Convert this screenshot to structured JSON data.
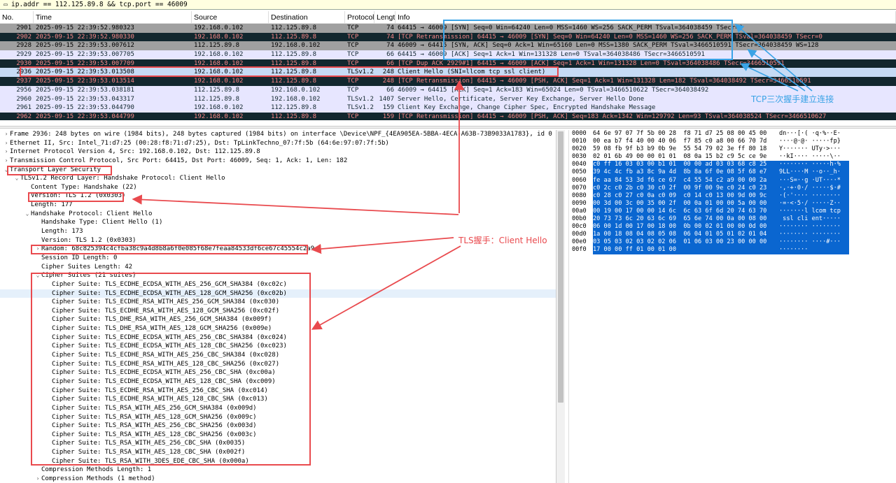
{
  "filter": {
    "icon": "bookmark-icon",
    "text": "ip.addr == 112.125.89.8 && tcp.port == 46009"
  },
  "columns": [
    "No.",
    "Time",
    "Source",
    "Destination",
    "Protocol",
    "Length",
    "Info"
  ],
  "packets": [
    {
      "no": "2901",
      "time": "2025-09-15 22:39:52.980323",
      "src": "192.168.0.102",
      "dst": "112.125.89.8",
      "proto": "TCP",
      "len": "74",
      "info": "64415 → 46009 [SYN] Seq=0 Win=64240 Len=0 MSS=1460 WS=256 SACK_PERM TSval=364038459 TSecr=0",
      "style": "gray"
    },
    {
      "no": "2902",
      "time": "2025-09-15 22:39:52.980330",
      "src": "192.168.0.102",
      "dst": "112.125.89.8",
      "proto": "TCP",
      "len": "74",
      "info": "[TCP Retransmission] 64415 → 46009 [SYN] Seq=0 Win=64240 Len=0 MSS=1460 WS=256 SACK_PERM TSval=364038459 TSecr=0",
      "style": "dark"
    },
    {
      "no": "2928",
      "time": "2025-09-15 22:39:53.007612",
      "src": "112.125.89.8",
      "dst": "192.168.0.102",
      "proto": "TCP",
      "len": "74",
      "info": "46009 → 64415 [SYN, ACK] Seq=0 Ack=1 Win=65160 Len=0 MSS=1380 SACK_PERM TSval=3466510591 TSecr=364038459 WS=128",
      "style": "gray"
    },
    {
      "no": "2929",
      "time": "2025-09-15 22:39:53.007705",
      "src": "192.168.0.102",
      "dst": "112.125.89.8",
      "proto": "TCP",
      "len": "66",
      "info": "64415 → 46009 [ACK] Seq=1 Ack=1 Win=131328 Len=0 TSval=364038486 TSecr=3466510591",
      "style": "lav"
    },
    {
      "no": "2930",
      "time": "2025-09-15 22:39:53.007709",
      "src": "192.168.0.102",
      "dst": "112.125.89.8",
      "proto": "TCP",
      "len": "66",
      "info": "[TCP Dup ACK 2929#1] 64415 → 46009 [ACK] Seq=1 Ack=1 Win=131328 Len=0 TSval=364038486 TSecr=3466510591",
      "style": "dark"
    },
    {
      "no": "2936",
      "time": "2025-09-15 22:39:53.013508",
      "src": "192.168.0.102",
      "dst": "112.125.89.8",
      "proto": "TLSv1.2",
      "len": "248",
      "info": "Client Hello (SNI=llcom tcp ssl client)",
      "style": "sel"
    },
    {
      "no": "2937",
      "time": "2025-09-15 22:39:53.013514",
      "src": "192.168.0.102",
      "dst": "112.125.89.8",
      "proto": "TCP",
      "len": "248",
      "info": "[TCP Retransmission] 64415 → 46009 [PSH, ACK] Seq=1 Ack=1 Win=131328 Len=182 TSval=364038492 TSecr=3466510591",
      "style": "dark"
    },
    {
      "no": "2956",
      "time": "2025-09-15 22:39:53.038181",
      "src": "112.125.89.8",
      "dst": "192.168.0.102",
      "proto": "TCP",
      "len": "66",
      "info": "46009 → 64415 [ACK] Seq=1 Ack=183 Win=65024 Len=0 TSval=3466510622 TSecr=364038492",
      "style": "lav"
    },
    {
      "no": "2960",
      "time": "2025-09-15 22:39:53.043317",
      "src": "112.125.89.8",
      "dst": "192.168.0.102",
      "proto": "TLSv1.2",
      "len": "1407",
      "info": "Server Hello, Certificate, Server Key Exchange, Server Hello Done",
      "style": "lav"
    },
    {
      "no": "2961",
      "time": "2025-09-15 22:39:53.044790",
      "src": "192.168.0.102",
      "dst": "112.125.89.8",
      "proto": "TLSv1.2",
      "len": "159",
      "info": "Client Key Exchange, Change Cipher Spec, Encrypted Handshake Message",
      "style": "lav"
    },
    {
      "no": "2962",
      "time": "2025-09-15 22:39:53.044799",
      "src": "192.168.0.102",
      "dst": "112.125.89.8",
      "proto": "TCP",
      "len": "159",
      "info": "[TCP Retransmission] 64415 → 46009 [PSH, ACK] Seq=183 Ack=1342 Win=129792 Len=93 TSval=364038524 TSecr=3466510627",
      "style": "dark"
    }
  ],
  "details": [
    {
      "indent": 0,
      "tw": "›",
      "text": "Frame 2936: 248 bytes on wire (1984 bits), 248 bytes captured (1984 bits) on interface \\Device\\NPF_{4EA905EA-5BBA-4ECA-A63B-73B9033A1783}, id 0"
    },
    {
      "indent": 0,
      "tw": "›",
      "text": "Ethernet II, Src: Intel_71:d7:25 (00:28:f8:71:d7:25), Dst: TpLinkTechno_07:7f:5b (64:6e:97:07:7f:5b)"
    },
    {
      "indent": 0,
      "tw": "›",
      "text": "Internet Protocol Version 4, Src: 192.168.0.102, Dst: 112.125.89.8"
    },
    {
      "indent": 0,
      "tw": "›",
      "text": "Transmission Control Protocol, Src Port: 64415, Dst Port: 46009, Seq: 1, Ack: 1, Len: 182"
    },
    {
      "indent": 0,
      "tw": "⌄",
      "text": "Transport Layer Security"
    },
    {
      "indent": 1,
      "tw": "⌄",
      "text": "TLSv1.2 Record Layer: Handshake Protocol: Client Hello"
    },
    {
      "indent": 2,
      "tw": "",
      "text": "Content Type: Handshake (22)"
    },
    {
      "indent": 2,
      "tw": "",
      "text": "Version: TLS 1.2 (0x0303)"
    },
    {
      "indent": 2,
      "tw": "",
      "text": "Length: 177"
    },
    {
      "indent": 2,
      "tw": "⌄",
      "text": "Handshake Protocol: Client Hello"
    },
    {
      "indent": 3,
      "tw": "",
      "text": "Handshake Type: Client Hello (1)"
    },
    {
      "indent": 3,
      "tw": "",
      "text": "Length: 173"
    },
    {
      "indent": 3,
      "tw": "",
      "text": "Version: TLS 1.2 (0x0303)"
    },
    {
      "indent": 3,
      "tw": "›",
      "text": "Random: 68c825394c4cfba38c9a4d8b8a6f0e085f68e7feaa84533df6ce67c45554c2a9"
    },
    {
      "indent": 3,
      "tw": "",
      "text": "Session ID Length: 0"
    },
    {
      "indent": 3,
      "tw": "",
      "text": "Cipher Suites Length: 42"
    },
    {
      "indent": 3,
      "tw": "⌄",
      "text": "Cipher Suites (21 suites)"
    },
    {
      "indent": 4,
      "tw": "",
      "text": "Cipher Suite: TLS_ECDHE_ECDSA_WITH_AES_256_GCM_SHA384 (0xc02c)"
    },
    {
      "indent": 4,
      "tw": "",
      "text": "Cipher Suite: TLS_ECDHE_ECDSA_WITH_AES_128_GCM_SHA256 (0xc02b)",
      "hl": true
    },
    {
      "indent": 4,
      "tw": "",
      "text": "Cipher Suite: TLS_ECDHE_RSA_WITH_AES_256_GCM_SHA384 (0xc030)"
    },
    {
      "indent": 4,
      "tw": "",
      "text": "Cipher Suite: TLS_ECDHE_RSA_WITH_AES_128_GCM_SHA256 (0xc02f)"
    },
    {
      "indent": 4,
      "tw": "",
      "text": "Cipher Suite: TLS_DHE_RSA_WITH_AES_256_GCM_SHA384 (0x009f)"
    },
    {
      "indent": 4,
      "tw": "",
      "text": "Cipher Suite: TLS_DHE_RSA_WITH_AES_128_GCM_SHA256 (0x009e)"
    },
    {
      "indent": 4,
      "tw": "",
      "text": "Cipher Suite: TLS_ECDHE_ECDSA_WITH_AES_256_CBC_SHA384 (0xc024)"
    },
    {
      "indent": 4,
      "tw": "",
      "text": "Cipher Suite: TLS_ECDHE_ECDSA_WITH_AES_128_CBC_SHA256 (0xc023)"
    },
    {
      "indent": 4,
      "tw": "",
      "text": "Cipher Suite: TLS_ECDHE_RSA_WITH_AES_256_CBC_SHA384 (0xc028)"
    },
    {
      "indent": 4,
      "tw": "",
      "text": "Cipher Suite: TLS_ECDHE_RSA_WITH_AES_128_CBC_SHA256 (0xc027)"
    },
    {
      "indent": 4,
      "tw": "",
      "text": "Cipher Suite: TLS_ECDHE_ECDSA_WITH_AES_256_CBC_SHA (0xc00a)"
    },
    {
      "indent": 4,
      "tw": "",
      "text": "Cipher Suite: TLS_ECDHE_ECDSA_WITH_AES_128_CBC_SHA (0xc009)"
    },
    {
      "indent": 4,
      "tw": "",
      "text": "Cipher Suite: TLS_ECDHE_RSA_WITH_AES_256_CBC_SHA (0xc014)"
    },
    {
      "indent": 4,
      "tw": "",
      "text": "Cipher Suite: TLS_ECDHE_RSA_WITH_AES_128_CBC_SHA (0xc013)"
    },
    {
      "indent": 4,
      "tw": "",
      "text": "Cipher Suite: TLS_RSA_WITH_AES_256_GCM_SHA384 (0x009d)"
    },
    {
      "indent": 4,
      "tw": "",
      "text": "Cipher Suite: TLS_RSA_WITH_AES_128_GCM_SHA256 (0x009c)"
    },
    {
      "indent": 4,
      "tw": "",
      "text": "Cipher Suite: TLS_RSA_WITH_AES_256_CBC_SHA256 (0x003d)"
    },
    {
      "indent": 4,
      "tw": "",
      "text": "Cipher Suite: TLS_RSA_WITH_AES_128_CBC_SHA256 (0x003c)"
    },
    {
      "indent": 4,
      "tw": "",
      "text": "Cipher Suite: TLS_RSA_WITH_AES_256_CBC_SHA (0x0035)"
    },
    {
      "indent": 4,
      "tw": "",
      "text": "Cipher Suite: TLS_RSA_WITH_AES_128_CBC_SHA (0x002f)"
    },
    {
      "indent": 4,
      "tw": "",
      "text": "Cipher Suite: TLS_RSA_WITH_3DES_EDE_CBC_SHA (0x000a)"
    },
    {
      "indent": 3,
      "tw": "",
      "text": "Compression Methods Length: 1"
    },
    {
      "indent": 3,
      "tw": "›",
      "text": "Compression Methods (1 method)"
    }
  ],
  "hex": [
    {
      "off": "0000",
      "bytes": "64 6e 97 07 7f 5b 00 28  f8 71 d7 25 08 00 45 00",
      "ascii": "dn···[·( ·q·%··E·"
    },
    {
      "off": "0010",
      "bytes": "00 ea b7 f4 40 00 40 06  f7 85 c0 a8 00 66 70 7d",
      "ascii": "····@·@· ·····fp}"
    },
    {
      "off": "0020",
      "bytes": "59 08 fb 9f b3 b9 0b 9e  55 54 79 02 3e ff 80 18",
      "ascii": "Y······· UTy·>···"
    },
    {
      "off": "0030",
      "bytes": "02 01 6b 49 00 00 01 01  08 0a 15 b2 c9 5c ce 9e",
      "ascii": "··kI···· ·····\\··"
    },
    {
      "off": "0040",
      "bytes": "c0 ff 16 03 03 00 b1 01  00 00 ad 03 03 68 c8 25",
      "ascii": "········ ·····h·%"
    },
    {
      "off": "0050",
      "bytes": "39 4c 4c fb a3 8c 9a 4d  8b 8a 6f 0e 08 5f 68 e7",
      "ascii": "9LL····M ··o··_h·"
    },
    {
      "off": "0060",
      "bytes": "fe aa 84 53 3d f6 ce 67  c4 55 54 c2 a9 00 00 2a",
      "ascii": "···S=··g ·UT····*"
    },
    {
      "off": "0070",
      "bytes": "c0 2c c0 2b c0 30 c0 2f  00 9f 00 9e c0 24 c0 23",
      "ascii": "·,·+·0·/ ·····$·#"
    },
    {
      "off": "0080",
      "bytes": "c0 28 c0 27 c0 0a c0 09  c0 14 c0 13 00 9d 00 9c",
      "ascii": "·(·'···· ········"
    },
    {
      "off": "0090",
      "bytes": "00 3d 00 3c 00 35 00 2f  00 0a 01 00 00 5a 00 00",
      "ascii": "·=·<·5·/ ·····Z··"
    },
    {
      "off": "00a0",
      "bytes": "00 19 00 17 00 00 14 6c  6c 63 6f 6d 20 74 63 70",
      "ascii": "·······l lcom tcp"
    },
    {
      "off": "00b0",
      "bytes": "20 73 73 6c 20 63 6c 69  65 6e 74 00 0a 00 08 00",
      "ascii": " ssl cli ent·····"
    },
    {
      "off": "00c0",
      "bytes": "06 00 1d 00 17 00 18 00  0b 00 02 01 00 00 0d 00",
      "ascii": "········ ········"
    },
    {
      "off": "00d0",
      "bytes": "1a 00 18 08 04 08 05 08  06 04 01 05 01 02 01 04",
      "ascii": "········ ········"
    },
    {
      "off": "00e0",
      "bytes": "03 05 03 02 03 02 02 06  01 06 03 00 23 00 00 00",
      "ascii": "········ ····#···"
    },
    {
      "off": "00f0",
      "bytes": "17 00 00 ff 01 00 01 00",
      "ascii": "········"
    }
  ],
  "annotations": {
    "tcp_label": "TCP三次握手建立连接",
    "tls_label": "TLS握手：Client Hello"
  },
  "colors": {
    "red_box": "#e94a4e",
    "blue_box": "#3aa3e6",
    "selection": "#0a66d0",
    "dark_row": "#12272e",
    "dark_row_text": "#f78787"
  }
}
